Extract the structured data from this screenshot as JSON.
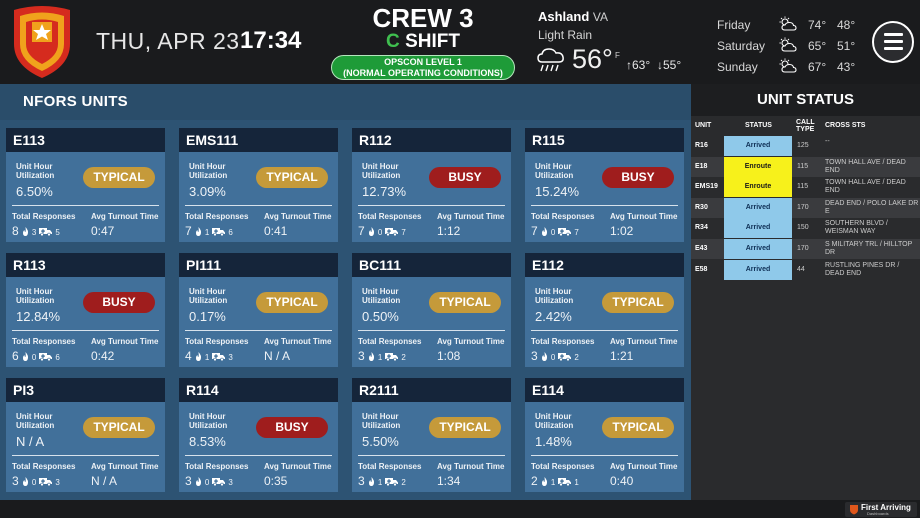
{
  "header": {
    "date": "THU, APR 23",
    "time": "17:34",
    "crew": "CREW 3",
    "shift_letter": "C",
    "shift_word": "SHIFT",
    "opscon_line1": "OPSCON LEVEL 1",
    "opscon_line2": "(NORMAL OPERATING CONDITIONS)",
    "opscon_color": "#1e9b38"
  },
  "weather": {
    "city": "Ashland",
    "state": "VA",
    "condition": "Light Rain",
    "temp": "56°",
    "unit": "F",
    "high": "63°",
    "low": "55°",
    "forecast": [
      {
        "day": "Friday",
        "high": "74°",
        "low": "48°",
        "icon": "partly-cloudy-icon"
      },
      {
        "day": "Saturday",
        "high": "65°",
        "low": "51°",
        "icon": "partly-cloudy-icon"
      },
      {
        "day": "Sunday",
        "high": "67°",
        "low": "43°",
        "icon": "partly-cloudy-icon"
      }
    ]
  },
  "units_panel": {
    "title": "NFORS UNITS",
    "labels": {
      "utilization_line1": "Unit Hour",
      "utilization_line2": "Utilization",
      "total_responses": "Total Responses",
      "avg_turnout": "Avg Turnout Time"
    },
    "units": [
      {
        "name": "E113",
        "utilization": "6.50%",
        "status": "TYPICAL",
        "total": "8",
        "fire": "3",
        "ems": "5",
        "turnout": "0:47"
      },
      {
        "name": "EMS111",
        "utilization": "3.09%",
        "status": "TYPICAL",
        "total": "7",
        "fire": "1",
        "ems": "6",
        "turnout": "0:41"
      },
      {
        "name": "R112",
        "utilization": "12.73%",
        "status": "BUSY",
        "total": "7",
        "fire": "0",
        "ems": "7",
        "turnout": "1:12"
      },
      {
        "name": "R115",
        "utilization": "15.24%",
        "status": "BUSY",
        "total": "7",
        "fire": "0",
        "ems": "7",
        "turnout": "1:02"
      },
      {
        "name": "R113",
        "utilization": "12.84%",
        "status": "BUSY",
        "total": "6",
        "fire": "0",
        "ems": "6",
        "turnout": "0:42"
      },
      {
        "name": "PI111",
        "utilization": "0.17%",
        "status": "TYPICAL",
        "total": "4",
        "fire": "1",
        "ems": "3",
        "turnout": "N / A"
      },
      {
        "name": "BC111",
        "utilization": "0.50%",
        "status": "TYPICAL",
        "total": "3",
        "fire": "1",
        "ems": "2",
        "turnout": "1:08"
      },
      {
        "name": "E112",
        "utilization": "2.42%",
        "status": "TYPICAL",
        "total": "3",
        "fire": "0",
        "ems": "2",
        "turnout": "1:21"
      },
      {
        "name": "PI3",
        "utilization": "N / A",
        "status": "TYPICAL",
        "total": "3",
        "fire": "0",
        "ems": "3",
        "turnout": "N / A"
      },
      {
        "name": "R114",
        "utilization": "8.53%",
        "status": "BUSY",
        "total": "3",
        "fire": "0",
        "ems": "3",
        "turnout": "0:35"
      },
      {
        "name": "R2111",
        "utilization": "5.50%",
        "status": "TYPICAL",
        "total": "3",
        "fire": "1",
        "ems": "2",
        "turnout": "1:34"
      },
      {
        "name": "E114",
        "utilization": "1.48%",
        "status": "TYPICAL",
        "total": "2",
        "fire": "1",
        "ems": "1",
        "turnout": "0:40"
      }
    ],
    "status_colors": {
      "TYPICAL": "#c59a3a",
      "BUSY": "#9f1d1d"
    }
  },
  "status_panel": {
    "title": "UNIT STATUS",
    "columns": [
      "UNIT",
      "STATUS",
      "CALL TYPE",
      "CROSS STS"
    ],
    "rows": [
      {
        "unit": "R16",
        "status": "Arrived",
        "call_type": "125",
        "cross": "--"
      },
      {
        "unit": "E18",
        "status": "Enroute",
        "call_type": "115",
        "cross": "TOWN HALL AVE / DEAD END"
      },
      {
        "unit": "EMS19",
        "status": "Enroute",
        "call_type": "115",
        "cross": "TOWN HALL AVE / DEAD END"
      },
      {
        "unit": "R30",
        "status": "Arrived",
        "call_type": "170",
        "cross": "DEAD END / POLO LAKE DR E"
      },
      {
        "unit": "R34",
        "status": "Arrived",
        "call_type": "150",
        "cross": "SOUTHERN BLVD / WEISMAN WAY"
      },
      {
        "unit": "E43",
        "status": "Arrived",
        "call_type": "170",
        "cross": "S MILITARY TRL / HILLTOP DR"
      },
      {
        "unit": "E58",
        "status": "Arrived",
        "call_type": "44",
        "cross": "RUSTLING PINES DR / DEAD END"
      }
    ],
    "status_colors": {
      "Arrived": "#8fc9ea",
      "Enroute": "#f7f11b"
    }
  },
  "footer": {
    "brand": "First Arriving",
    "brand_sub": "Dashboards"
  }
}
